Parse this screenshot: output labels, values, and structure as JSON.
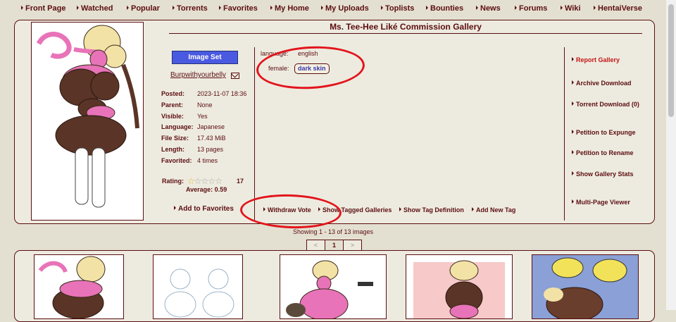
{
  "nav": [
    "Front Page",
    "Watched",
    "Popular",
    "Torrents",
    "Favorites",
    "My Home",
    "My Uploads",
    "Toplists",
    "Bounties",
    "News",
    "Forums",
    "Wiki",
    "HentaiVerse"
  ],
  "gallery": {
    "title": "Ms. Tee-Hee Liké Commission Gallery",
    "category": "Image Set",
    "uploader": "Burpwithyourbelly"
  },
  "meta": [
    {
      "label": "Posted:",
      "value": "2023-11-07 18:36"
    },
    {
      "label": "Parent:",
      "value": "None"
    },
    {
      "label": "Visible:",
      "value": "Yes"
    },
    {
      "label": "Language:",
      "value": "Japanese"
    },
    {
      "label": "File Size:",
      "value": "17.43 MiB"
    },
    {
      "label": "Length:",
      "value": "13 pages"
    },
    {
      "label": "Favorited:",
      "value": "4 times"
    }
  ],
  "rating": {
    "label": "Rating:",
    "count": "17",
    "average": "Average: 0.59",
    "stars_filled_fraction": 0.12
  },
  "add_favorites": "Add to Favorites",
  "tags": {
    "language_ns": "language:",
    "language_val": "english",
    "female_ns": "female:",
    "female_tag": "dark skin"
  },
  "tag_actions": [
    "Withdraw Vote",
    "Show Tagged Galleries",
    "Show Tag Definition",
    "Add New Tag"
  ],
  "side_actions": [
    "Report Gallery",
    "Archive Download",
    "Torrent Download (0)",
    "Petition to Expunge",
    "Petition to Rename",
    "Show Gallery Stats",
    "Multi-Page Viewer"
  ],
  "showing": "Showing 1 - 13 of 13 images",
  "pager": [
    "<",
    "1",
    ">"
  ],
  "colors": {
    "background": "#e3e0d1",
    "panel": "#edebdf",
    "text": "#5c0d11",
    "annotation_red": "#e3141c",
    "category_blue": "#4a5ae0",
    "report_red": "#c41616"
  }
}
